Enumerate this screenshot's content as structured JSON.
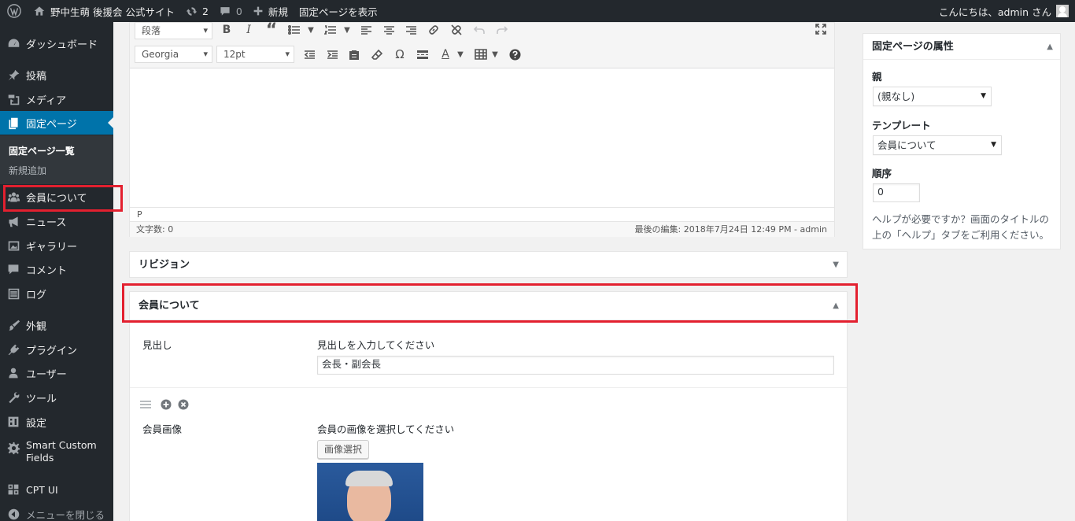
{
  "adminbar": {
    "site_name": "野中生萌 後援会 公式サイト",
    "updates_count": "2",
    "comments_count": "0",
    "new_label": "新規",
    "view_page_label": "固定ページを表示",
    "greeting": "こんにちは、admin さん"
  },
  "sidebar": {
    "items": [
      {
        "label": "ダッシュボード",
        "icon": "dashboard-icon"
      },
      {
        "label": "投稿",
        "icon": "pin-icon"
      },
      {
        "label": "メディア",
        "icon": "media-icon"
      },
      {
        "label": "固定ページ",
        "icon": "page-icon"
      },
      {
        "label": "会員について",
        "icon": "groups-icon"
      },
      {
        "label": "ニュース",
        "icon": "megaphone-icon"
      },
      {
        "label": "ギャラリー",
        "icon": "gallery-icon"
      },
      {
        "label": "コメント",
        "icon": "comment-icon"
      },
      {
        "label": "ログ",
        "icon": "list-icon"
      },
      {
        "label": "外観",
        "icon": "brush-icon"
      },
      {
        "label": "プラグイン",
        "icon": "plugin-icon"
      },
      {
        "label": "ユーザー",
        "icon": "user-icon"
      },
      {
        "label": "ツール",
        "icon": "wrench-icon"
      },
      {
        "label": "設定",
        "icon": "settings-icon"
      },
      {
        "label": "Smart Custom Fields",
        "icon": "gear-icon"
      },
      {
        "label": "CPT UI",
        "icon": "grid-icon"
      }
    ],
    "submenu": {
      "current": "固定ページ一覧",
      "add_new": "新規追加"
    },
    "collapse_label": "メニューを閉じる"
  },
  "editor": {
    "format_select": "段落",
    "font_select": "Georgia",
    "size_select": "12pt",
    "path": "P",
    "word_count": "文字数: 0",
    "last_edit": "最後の編集: 2018年7月24日 12:49 PM - admin"
  },
  "revisions": {
    "title": "リビジョン"
  },
  "kaiin_box": {
    "title": "会員について",
    "heading_label": "見出し",
    "heading_desc": "見出しを入力してください",
    "heading_value": "会長・副会長",
    "image_label": "会員画像",
    "image_desc": "会員の画像を選択してください",
    "image_button": "画像選択"
  },
  "attributes": {
    "title": "固定ページの属性",
    "parent_label": "親",
    "parent_value": "(親なし)",
    "template_label": "テンプレート",
    "template_value": "会員について",
    "order_label": "順序",
    "order_value": "0",
    "help_text": "ヘルプが必要ですか？画面のタイトルの上の「ヘルプ」タブをご利用ください。"
  },
  "colors": {
    "admin_bg": "#23282d",
    "accent": "#0073aa",
    "highlight": "#e3202f"
  }
}
